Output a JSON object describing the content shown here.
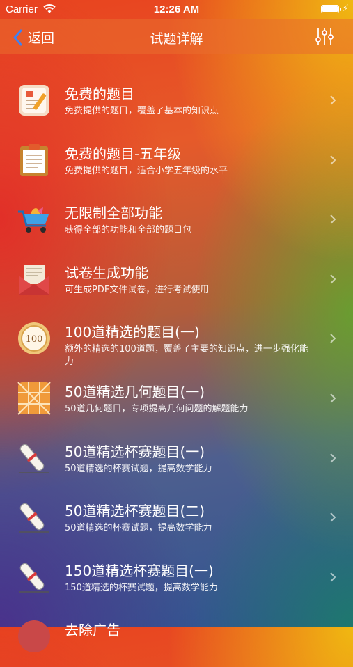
{
  "status": {
    "carrier": "Carrier",
    "time": "12:26 AM"
  },
  "nav": {
    "back_label": "返回",
    "title": "试题详解"
  },
  "items": [
    {
      "title": "免费的题目",
      "subtitle": "免费提供的题目，覆盖了基本的知识点",
      "icon": "notepad-pencil-icon"
    },
    {
      "title": "免费的题目-五年级",
      "subtitle": "免费提供的题目，适合小学五年级的水平",
      "icon": "clipboard-icon"
    },
    {
      "title": "无限制全部功能",
      "subtitle": "获得全部的功能和全部的题目包",
      "icon": "shopping-cart-icon"
    },
    {
      "title": "试卷生成功能",
      "subtitle": "可生成PDF文件试卷，进行考试使用",
      "icon": "envelope-icon"
    },
    {
      "title": "100道精选的题目(一)",
      "subtitle": "额外的精选的100道题，覆盖了主要的知识点，进一步强化能力",
      "icon": "badge-100-icon"
    },
    {
      "title": "50道精选几何题目(一)",
      "subtitle": "50道几何题目，专项提高几何问题的解题能力",
      "icon": "geometry-grid-icon"
    },
    {
      "title": "50道精选杯赛题目(一)",
      "subtitle": "50道精选的杯赛试题，提高数学能力",
      "icon": "scroll-icon"
    },
    {
      "title": "50道精选杯赛题目(二)",
      "subtitle": "50道精选的杯赛试题，提高数学能力",
      "icon": "scroll-icon"
    },
    {
      "title": "150道精选杯赛题目(一)",
      "subtitle": "150道精选的杯赛试题，提高数学能力",
      "icon": "scroll-icon"
    },
    {
      "title": "去除广告",
      "subtitle": "",
      "icon": "no-ads-icon"
    }
  ]
}
